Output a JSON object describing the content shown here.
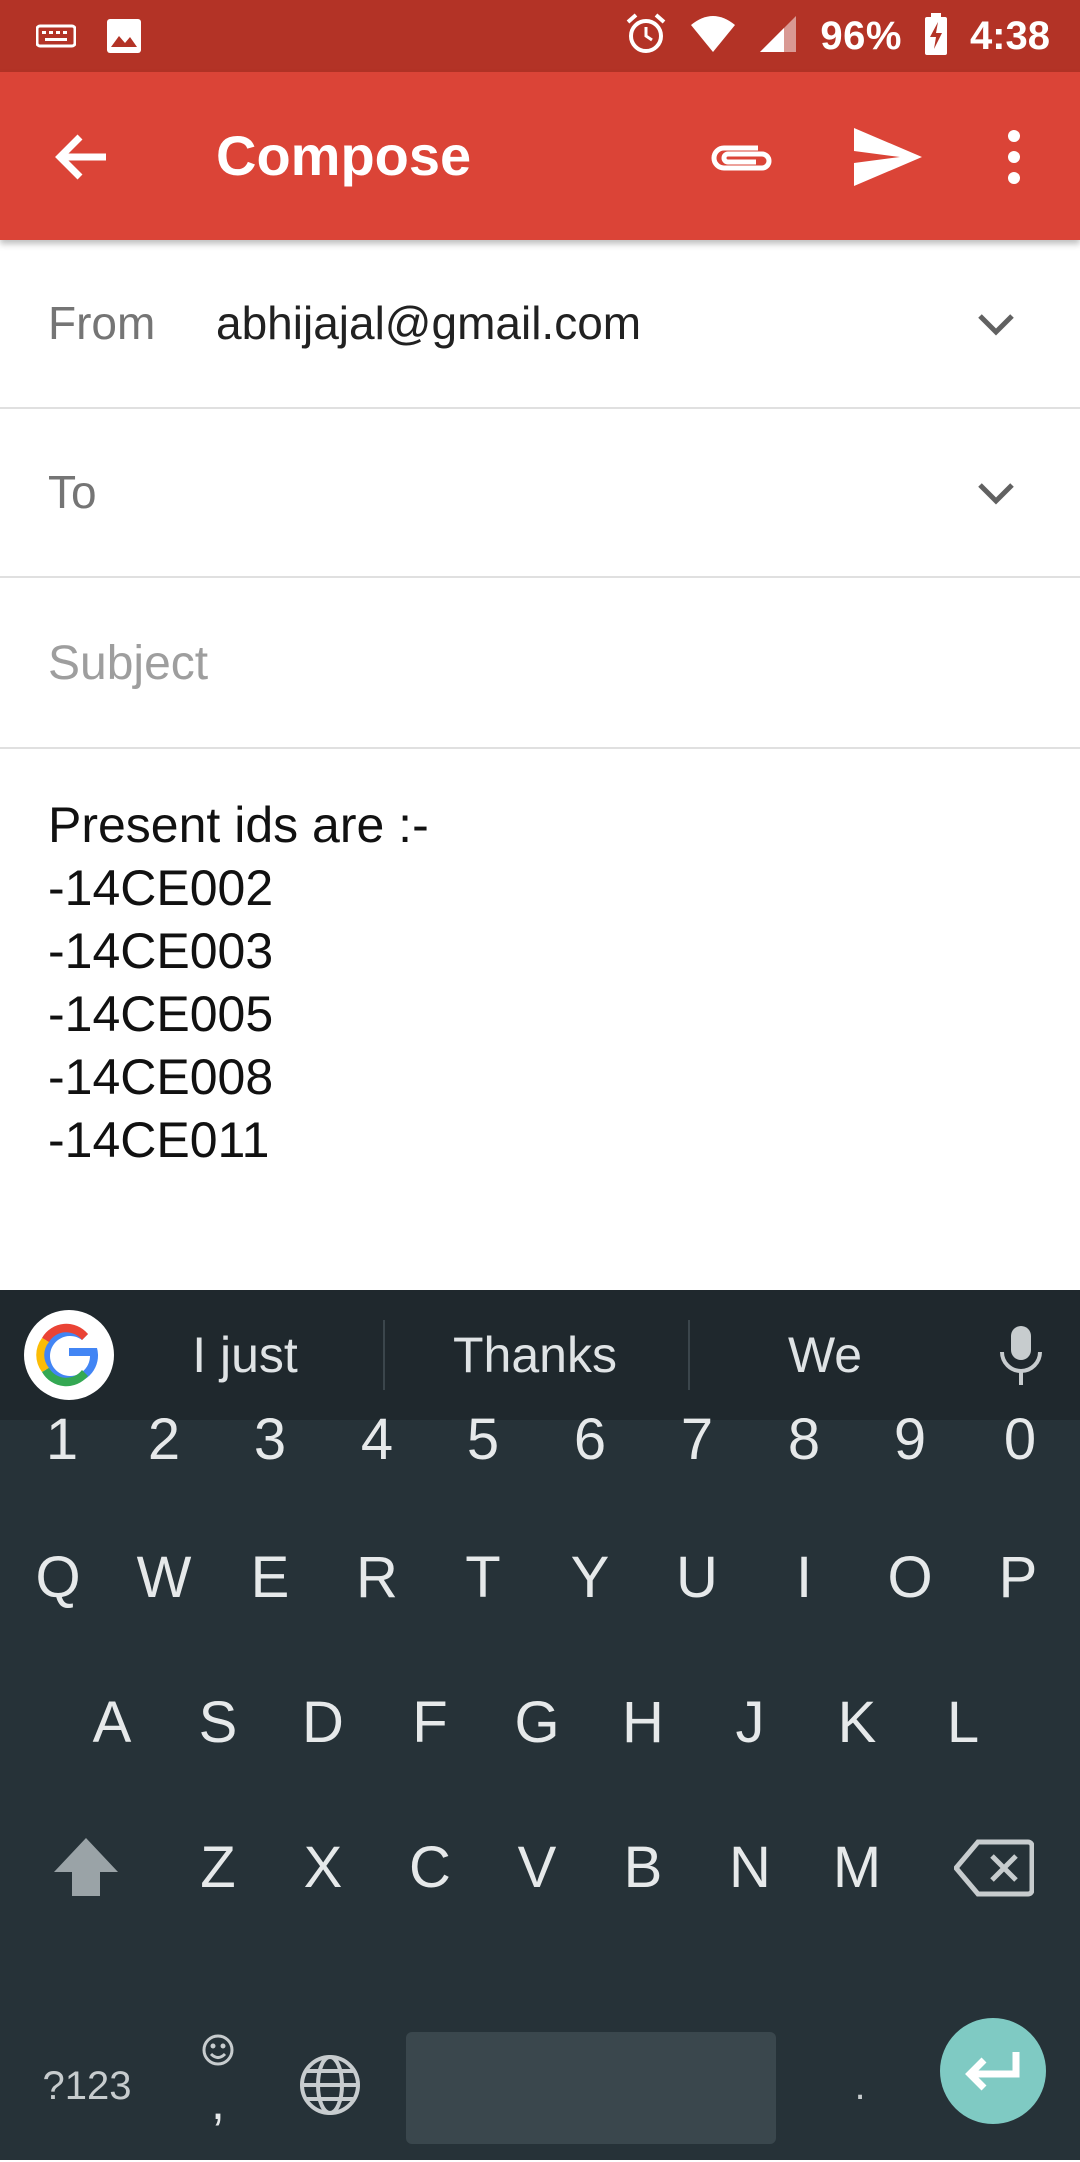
{
  "status_bar": {
    "battery": "96%",
    "time": "4:38",
    "icons": [
      "keyboard-icon",
      "image-icon",
      "alarm-icon",
      "wifi-icon",
      "signal-icon",
      "battery-charging-icon"
    ]
  },
  "app_bar": {
    "title": "Compose",
    "color": "#db4437",
    "icons": [
      "back-arrow-icon",
      "attachment-icon",
      "send-icon",
      "more-vert-icon"
    ]
  },
  "compose": {
    "from_label": "From",
    "from_value": "abhijajal@gmail.com",
    "to_label": "To",
    "subject_placeholder": "Subject",
    "body_lines": [
      "Present ids are :-",
      "-14CE002",
      "-14CE003",
      "-14CE005",
      "-14CE008",
      "-14CE011"
    ]
  },
  "keyboard": {
    "suggestions": [
      "I just",
      "Thanks",
      "We"
    ],
    "number_row": [
      "1",
      "2",
      "3",
      "4",
      "5",
      "6",
      "7",
      "8",
      "9",
      "0"
    ],
    "row1": [
      "Q",
      "W",
      "E",
      "R",
      "T",
      "Y",
      "U",
      "I",
      "O",
      "P"
    ],
    "row2": [
      "A",
      "S",
      "D",
      "F",
      "G",
      "H",
      "J",
      "K",
      "L"
    ],
    "row3": [
      "Z",
      "X",
      "C",
      "V",
      "B",
      "N",
      "M"
    ],
    "symbols_key": "?123",
    "emoji_comma": ",",
    "period": ".",
    "enter_color": "#7fcac3"
  }
}
